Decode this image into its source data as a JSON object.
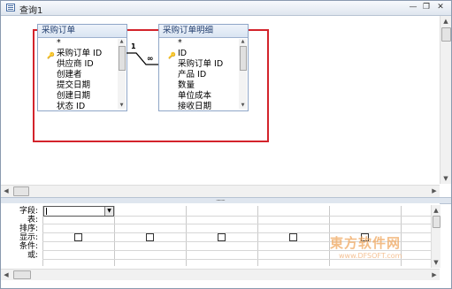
{
  "window": {
    "title": "查询1",
    "minimize_glyph": "—",
    "restore_glyph": "❐",
    "close_glyph": "✕"
  },
  "tables": [
    {
      "name": "采购订单",
      "fields": [
        {
          "label": "*",
          "key": false
        },
        {
          "label": "采购订单 ID",
          "key": true
        },
        {
          "label": "供应商 ID",
          "key": false
        },
        {
          "label": "创建者",
          "key": false
        },
        {
          "label": "提交日期",
          "key": false
        },
        {
          "label": "创建日期",
          "key": false
        },
        {
          "label": "状态 ID",
          "key": false
        }
      ]
    },
    {
      "name": "采购订单明细",
      "fields": [
        {
          "label": "*",
          "key": false
        },
        {
          "label": "ID",
          "key": true
        },
        {
          "label": "采购订单 ID",
          "key": false
        },
        {
          "label": "产品 ID",
          "key": false
        },
        {
          "label": "数量",
          "key": false
        },
        {
          "label": "单位成本",
          "key": false
        },
        {
          "label": "接收日期",
          "key": false
        }
      ]
    }
  ],
  "relationship": {
    "one_label": "1",
    "many_label": "∞"
  },
  "grid": {
    "row_labels": [
      "字段:",
      "表:",
      "排序:",
      "显示:",
      "条件:",
      "或:"
    ],
    "show_checkbox_count": 6
  },
  "watermark": {
    "main": "東方软件网",
    "sub": "www.DFSOFT.com"
  },
  "colors": {
    "highlight_border": "#d3232b",
    "table_header": "#d9e4f2"
  },
  "icons": {
    "window": "query-window-icon",
    "key": "primary-key-icon"
  }
}
